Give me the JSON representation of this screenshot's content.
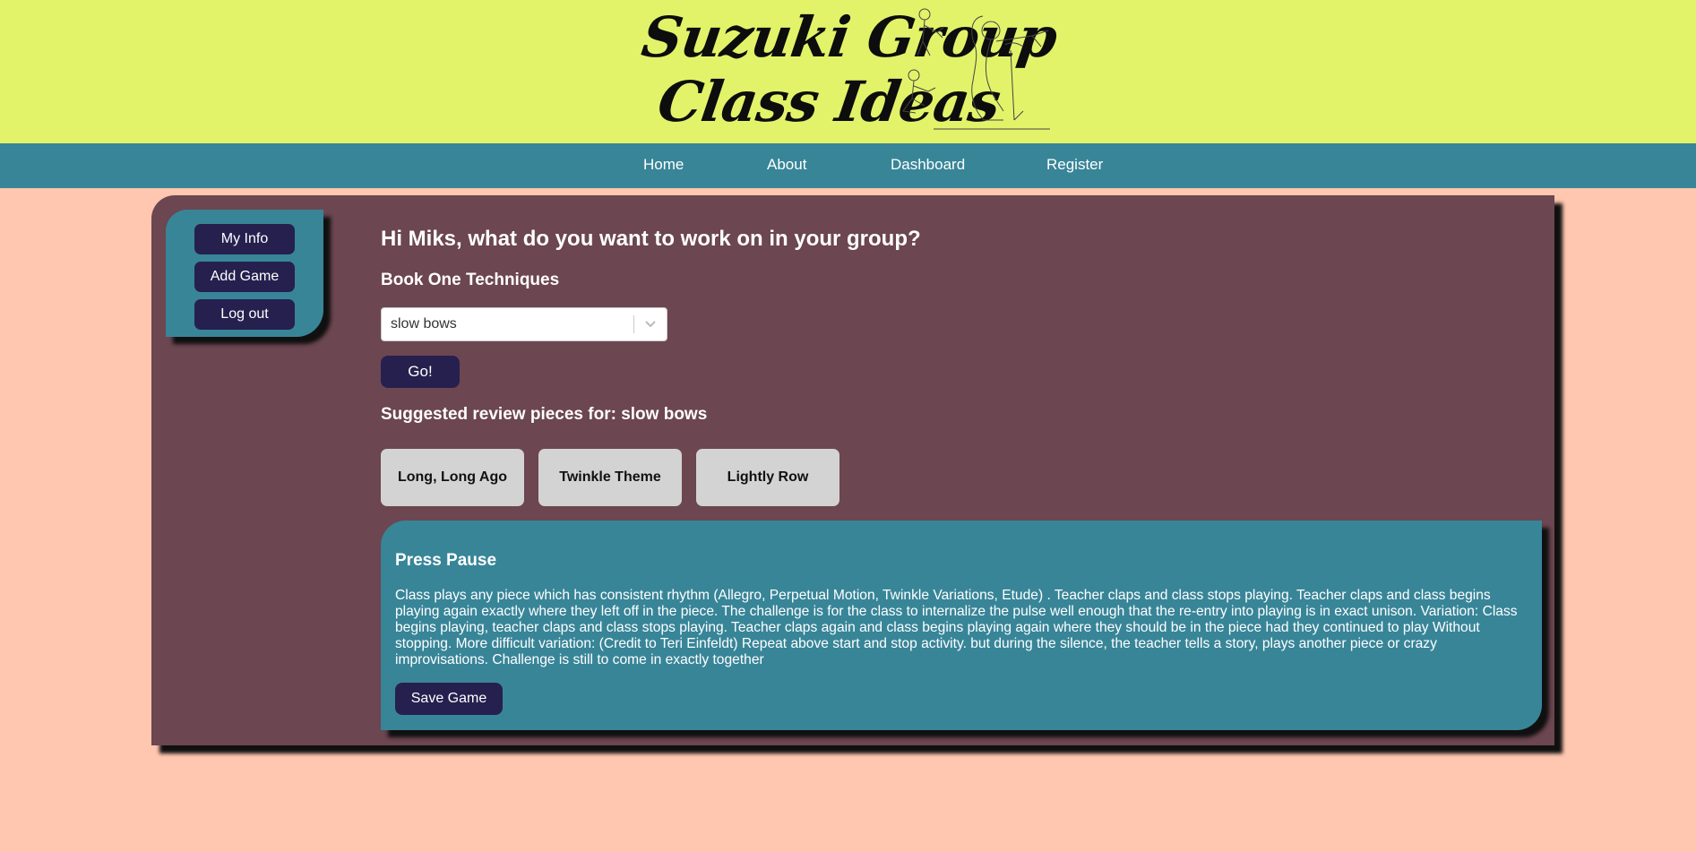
{
  "header": {
    "logo_line1": "Suzuki Group",
    "logo_line2": "Class Ideas"
  },
  "nav": {
    "items": [
      {
        "label": "Home"
      },
      {
        "label": "About"
      },
      {
        "label": "Dashboard"
      },
      {
        "label": "Register"
      }
    ]
  },
  "sidebar": {
    "buttons": [
      {
        "label": "My Info"
      },
      {
        "label": "Add Game"
      },
      {
        "label": "Log out"
      }
    ]
  },
  "main": {
    "greeting": "Hi Miks, what do you want to work on in your group?",
    "technique_heading": "Book One Techniques",
    "technique_select": {
      "selected": "slow bows"
    },
    "go_label": "Go!",
    "suggest_heading": "Suggested review pieces for: slow bows",
    "pieces": [
      {
        "label": "Long, Long Ago"
      },
      {
        "label": "Twinkle Theme"
      },
      {
        "label": "Lightly Row"
      }
    ]
  },
  "game": {
    "title": "Press Pause",
    "description": "Class plays any piece which has consistent rhythm (Allegro, Perpetual Motion, Twinkle Variations, Etude) . Teacher claps and class stops playing. Teacher claps and class begins playing again exactly where they left off in the piece. The challenge is for the class to internalize the pulse well enough that the re-entry into playing is in exact unison. Variation: Class begins playing, teacher claps and class stops playing. Teacher claps again and class begins playing again where they should be in the piece had they continued to play Without stopping. More difficult variation: (Credit to Teri Einfeldt) Repeat above start and stop activity. but during the silence, the teacher tells a story, plays another piece or crazy improvisations. Challenge is still to come in exactly together",
    "save_label": "Save Game"
  },
  "colors": {
    "header_bg": "#e2f36a",
    "nav_bg": "#388598",
    "page_bg": "#ffc6b0",
    "panel_bg": "#6c4650",
    "button_bg": "#26204f",
    "piece_bg": "#d3d3d3"
  },
  "icons": {
    "logo_art": "violinists-line-drawing",
    "select_chevron": "chevron-down-icon"
  }
}
